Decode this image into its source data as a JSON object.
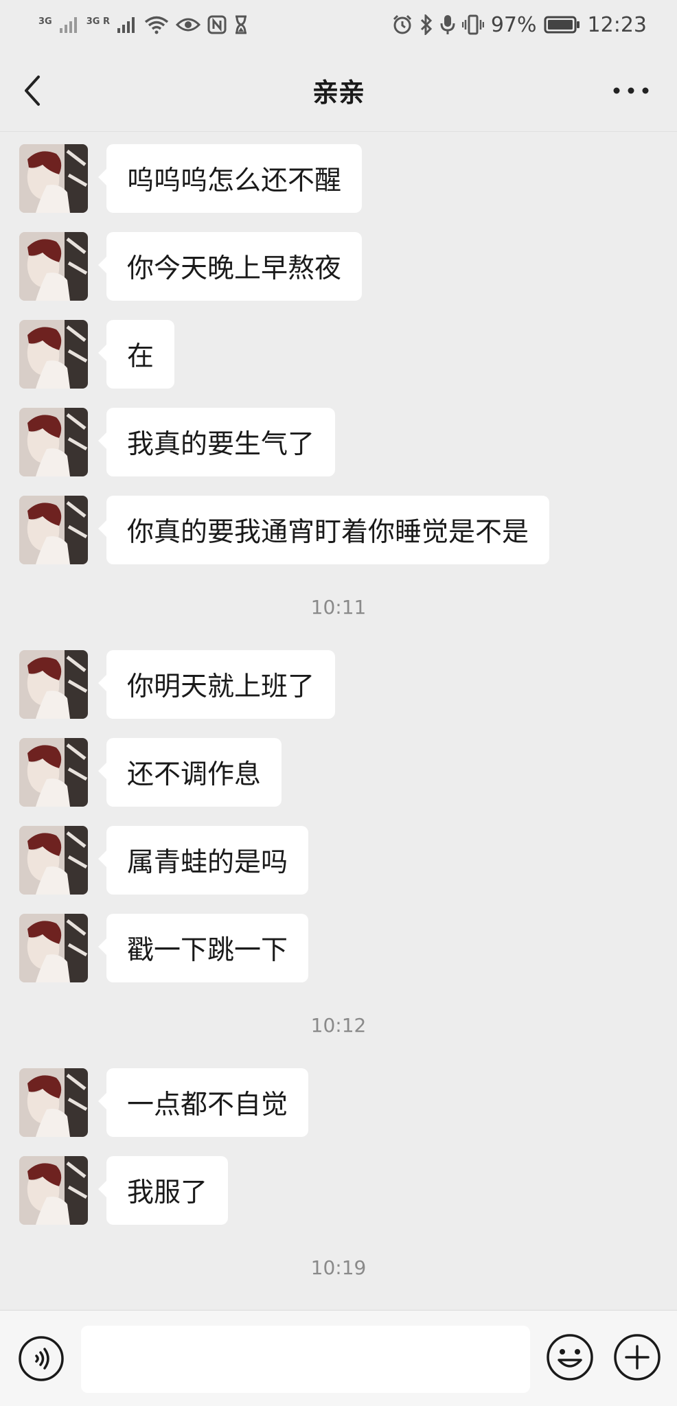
{
  "status_bar": {
    "network_1": "3G",
    "network_2": "3G R",
    "battery": "97%",
    "time": "12:23"
  },
  "header": {
    "title": "亲亲"
  },
  "messages": [
    {
      "text": "呜呜呜怎么还不醒"
    },
    {
      "text": "你今天晚上早熬夜"
    },
    {
      "text": "在"
    },
    {
      "text": "我真的要生气了"
    },
    {
      "text": "你真的要我通宵盯着你睡觉是不是"
    },
    {
      "timestamp": "10:11"
    },
    {
      "text": "你明天就上班了"
    },
    {
      "text": "还不调作息"
    },
    {
      "text": "属青蛙的是吗"
    },
    {
      "text": "戳一下跳一下"
    },
    {
      "timestamp": "10:12"
    },
    {
      "text": "一点都不自觉"
    },
    {
      "text": "我服了"
    },
    {
      "timestamp": "10:19"
    }
  ],
  "input": {
    "value": ""
  },
  "icons": [
    "signal-icon",
    "wifi-icon",
    "eye-icon",
    "nfc-icon",
    "hourglass-icon",
    "alarm-icon",
    "bluetooth-icon",
    "mic-icon",
    "vibrate-icon",
    "battery-icon",
    "back-arrow-icon",
    "more-icon",
    "voice-icon",
    "emoji-icon",
    "plus-icon"
  ],
  "colors": {
    "background": "#ededed",
    "bubble": "#ffffff",
    "text": "#1a1a1a",
    "timestamp": "#8a8a8a"
  }
}
